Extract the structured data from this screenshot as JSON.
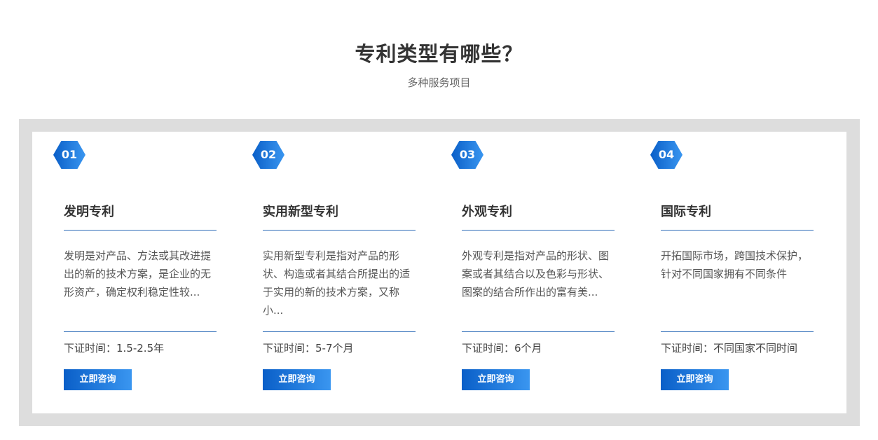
{
  "header": {
    "title": "专利类型有哪些？",
    "subtitle": "多种服务项目"
  },
  "cards": [
    {
      "number": "01",
      "title": "发明专利",
      "description": "发明是对产品、方法或其改进提出的新的技术方案，是企业的无形资产，确定权利稳定性较...",
      "time": "下证时间：1.5-2.5年",
      "button_label": "立即咨询"
    },
    {
      "number": "02",
      "title": "实用新型专利",
      "description": "实用新型专利是指对产品的形状、构造或者其结合所提出的适于实用的新的技术方案，又称小...",
      "time": "下证时间：5-7个月",
      "button_label": "立即咨询"
    },
    {
      "number": "03",
      "title": "外观专利",
      "description": "外观专利是指对产品的形状、图案或者其结合以及色彩与形状、图案的结合所作出的富有美...",
      "time": "下证时间：6个月",
      "button_label": "立即咨询"
    },
    {
      "number": "04",
      "title": "国际专利",
      "description": "开拓国际市场，跨国技术保护，针对不同国家拥有不同条件",
      "time": "下证时间：不同国家不同时间",
      "button_label": "立即咨询"
    }
  ],
  "colors": {
    "accent_start": "#0a5fc8",
    "accent_end": "#3a96f0",
    "divider": "#2f6db8",
    "frame": "#dddddd"
  }
}
